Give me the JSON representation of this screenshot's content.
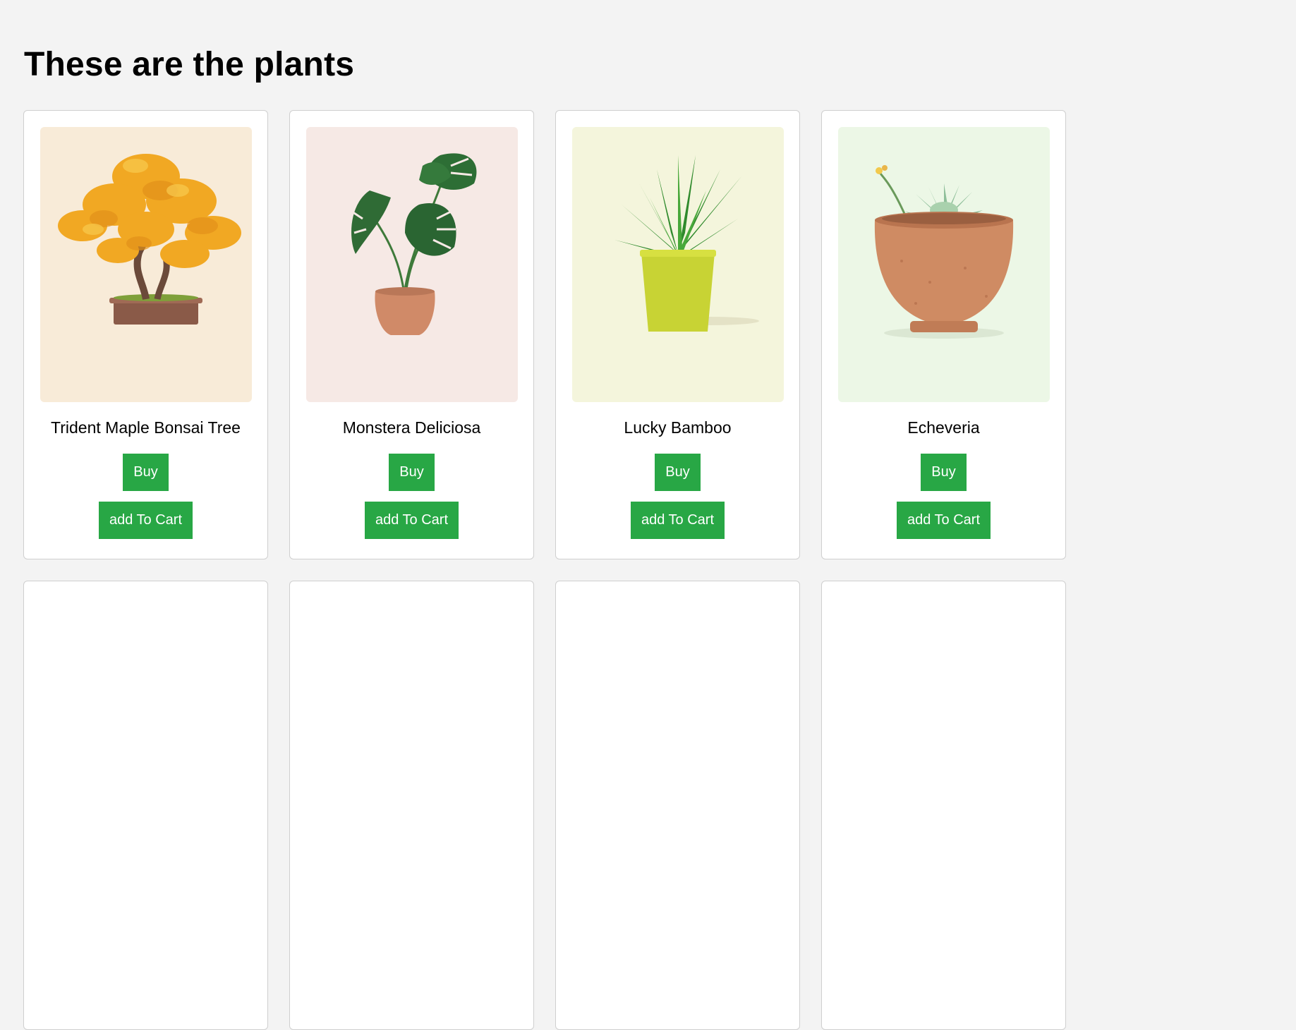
{
  "page": {
    "title": "These are the plants"
  },
  "products": [
    {
      "name": "Trident Maple Bonsai Tree",
      "buy_label": "Buy",
      "cart_label": "add To Cart",
      "image_bg": "#f8ebd8",
      "image_icon": "bonsai-tree-image"
    },
    {
      "name": "Monstera Deliciosa",
      "buy_label": "Buy",
      "cart_label": "add To Cart",
      "image_bg": "#f6e9e5",
      "image_icon": "monstera-plant-image"
    },
    {
      "name": "Lucky Bamboo",
      "buy_label": "Buy",
      "cart_label": "add To Cart",
      "image_bg": "#f4f5dc",
      "image_icon": "lucky-bamboo-image"
    },
    {
      "name": "Echeveria",
      "buy_label": "Buy",
      "cart_label": "add To Cart",
      "image_bg": "#ecf7e6",
      "image_icon": "echeveria-succulent-image"
    }
  ],
  "colors": {
    "button": "#28a745",
    "page_bg": "#f3f3f3"
  }
}
